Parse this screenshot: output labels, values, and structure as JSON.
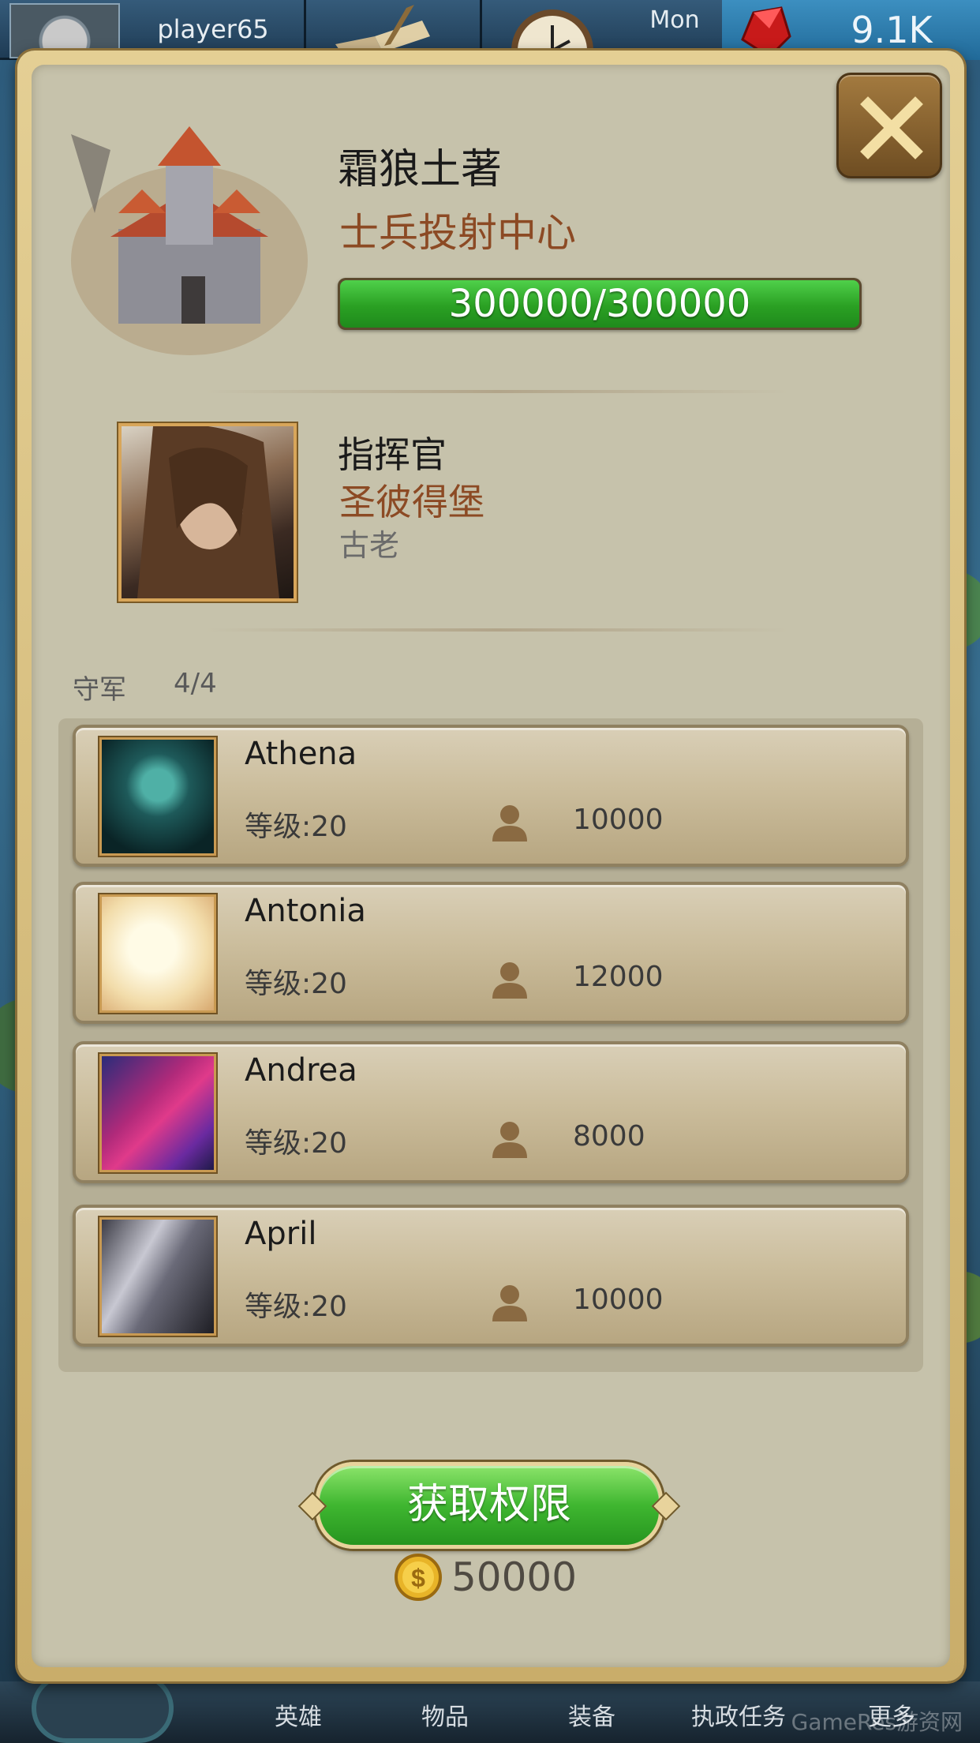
{
  "topbar": {
    "player_name": "player65",
    "day": "Mon",
    "gems": "9.1K"
  },
  "building": {
    "name": "霜狼土著",
    "type": "士兵投射中心",
    "hp_text": "300000/300000",
    "hp_fraction": 1.0
  },
  "commander": {
    "title": "指挥官",
    "name": "圣彼得堡",
    "rank": "古老"
  },
  "garrison": {
    "label": "守军",
    "count": "4/4",
    "heroes": [
      {
        "name": "Athena",
        "level": "等级:20",
        "troops": "10000"
      },
      {
        "name": "Antonia",
        "level": "等级:20",
        "troops": "12000"
      },
      {
        "name": "Andrea",
        "level": "等级:20",
        "troops": "8000"
      },
      {
        "name": "April",
        "level": "等级:20",
        "troops": "10000"
      }
    ]
  },
  "action": {
    "button_label": "获取权限",
    "cost": "50000"
  },
  "bottom_nav": {
    "items": [
      "英雄",
      "物品",
      "装备",
      "执政任务",
      "更多"
    ]
  },
  "watermark": "GameRes游资网",
  "colors": {
    "accent_text": "#8c4a24",
    "hp_green": "#2aa023",
    "button_green": "#3fb630",
    "frame_gold": "#d8a65a"
  }
}
